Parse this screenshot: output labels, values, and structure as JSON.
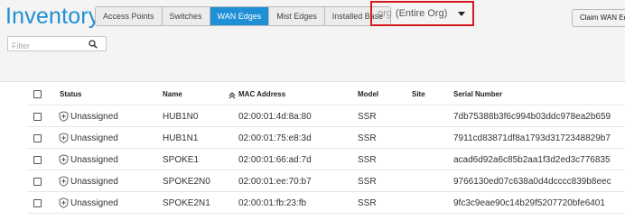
{
  "header": {
    "title": "Inventory",
    "tabs": [
      {
        "label": "Access Points",
        "active": false
      },
      {
        "label": "Switches",
        "active": false
      },
      {
        "label": "WAN Edges",
        "active": true
      },
      {
        "label": "Mist Edges",
        "active": false
      },
      {
        "label": "Installed Base",
        "active": false
      }
    ],
    "org_select": {
      "prefix": "org",
      "value": "(Entire Org)"
    },
    "claim_button": "Claim WAN Ed"
  },
  "filter": {
    "placeholder": "Filter",
    "value": ""
  },
  "table": {
    "columns": [
      "Status",
      "Name",
      "MAC Address",
      "Model",
      "Site",
      "Serial Number"
    ],
    "rows": [
      {
        "status": "Unassigned",
        "name": "HUB1N0",
        "mac": "02:00:01:4d:8a:80",
        "model": "SSR",
        "site": "",
        "serial": "7db75388b3f6c994b03ddc978ea2b659"
      },
      {
        "status": "Unassigned",
        "name": "HUB1N1",
        "mac": "02:00:01:75:e8:3d",
        "model": "SSR",
        "site": "",
        "serial": "7911cd83871df8a1793d3172348829b7"
      },
      {
        "status": "Unassigned",
        "name": "SPOKE1",
        "mac": "02:00:01:66:ad:7d",
        "model": "SSR",
        "site": "",
        "serial": "acad6d92a6c85b2aa1f3d2ed3c776835"
      },
      {
        "status": "Unassigned",
        "name": "SPOKE2N0",
        "mac": "02:00:01:ee:70:b7",
        "model": "SSR",
        "site": "",
        "serial": "9766130ed07c638a0d4dcccc839b8eec"
      },
      {
        "status": "Unassigned",
        "name": "SPOKE2N1",
        "mac": "02:00:01:fb:23:fb",
        "model": "SSR",
        "site": "",
        "serial": "9fc3c9eae90c14b29f5207720bfe6401"
      }
    ]
  },
  "colors": {
    "accent": "#1f8fd6",
    "highlight": "#d6191f"
  }
}
